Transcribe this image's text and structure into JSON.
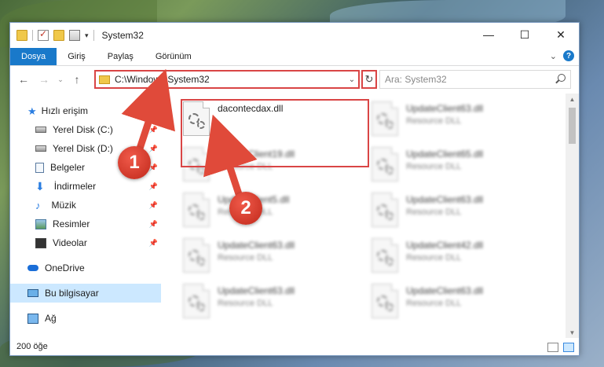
{
  "window": {
    "title": "System32",
    "controls": {
      "minimize": "—",
      "maximize": "☐",
      "close": "✕"
    }
  },
  "ribbon": {
    "tabs": [
      "Dosya",
      "Giriş",
      "Paylaş",
      "Görünüm"
    ],
    "expand": "⌄",
    "help": "?"
  },
  "nav": {
    "back": "←",
    "forward": "→",
    "recent": "⌄",
    "up": "↑",
    "address": "C:\\Windows\\System32",
    "address_dropdown": "⌄",
    "refresh": "↻",
    "search_placeholder": "Ara: System32"
  },
  "sidebar": {
    "items": [
      {
        "label": "Hızlı erişim",
        "icon": "star-icon"
      },
      {
        "label": "Yerel Disk (C:)",
        "icon": "disk-icon",
        "pinned": true
      },
      {
        "label": "Yerel Disk (D:)",
        "icon": "disk-icon",
        "pinned": true
      },
      {
        "label": "Belgeler",
        "icon": "document-icon",
        "pinned": true
      },
      {
        "label": "İndirmeler",
        "icon": "download-icon",
        "pinned": true
      },
      {
        "label": "Müzik",
        "icon": "music-icon",
        "pinned": true
      },
      {
        "label": "Resimler",
        "icon": "pictures-icon",
        "pinned": true
      },
      {
        "label": "Videolar",
        "icon": "video-icon",
        "pinned": true
      },
      {
        "label": "OneDrive",
        "icon": "cloud-icon"
      },
      {
        "label": "Bu bilgisayar",
        "icon": "computer-icon",
        "selected": true
      },
      {
        "label": "Ağ",
        "icon": "network-icon"
      }
    ],
    "pin_glyph": "📌"
  },
  "files": [
    {
      "name": "dacontecdax.dll",
      "sub": ""
    },
    {
      "name": "UpdateClient63.dll",
      "sub": "Resource DLL"
    },
    {
      "name": "UpdateClient19.dll",
      "sub": "Resource DLL"
    },
    {
      "name": "UpdateClient65.dll",
      "sub": "Resource DLL"
    },
    {
      "name": "UpdateClient5.dll",
      "sub": "Resource DLL"
    },
    {
      "name": "UpdateClient63.dll",
      "sub": "Resource DLL"
    },
    {
      "name": "UpdateClient63.dll",
      "sub": "Resource DLL"
    },
    {
      "name": "UpdateClient42.dll",
      "sub": "Resource DLL"
    },
    {
      "name": "UpdateClient63.dll",
      "sub": "Resource DLL"
    },
    {
      "name": "UpdateClient63.dll",
      "sub": "Resource DLL"
    }
  ],
  "status": {
    "count": "200 öğe"
  },
  "annotations": {
    "marker1": "1",
    "marker2": "2"
  },
  "colors": {
    "accent": "#1979ca",
    "highlight": "#d94545",
    "selected": "#cce8ff"
  }
}
